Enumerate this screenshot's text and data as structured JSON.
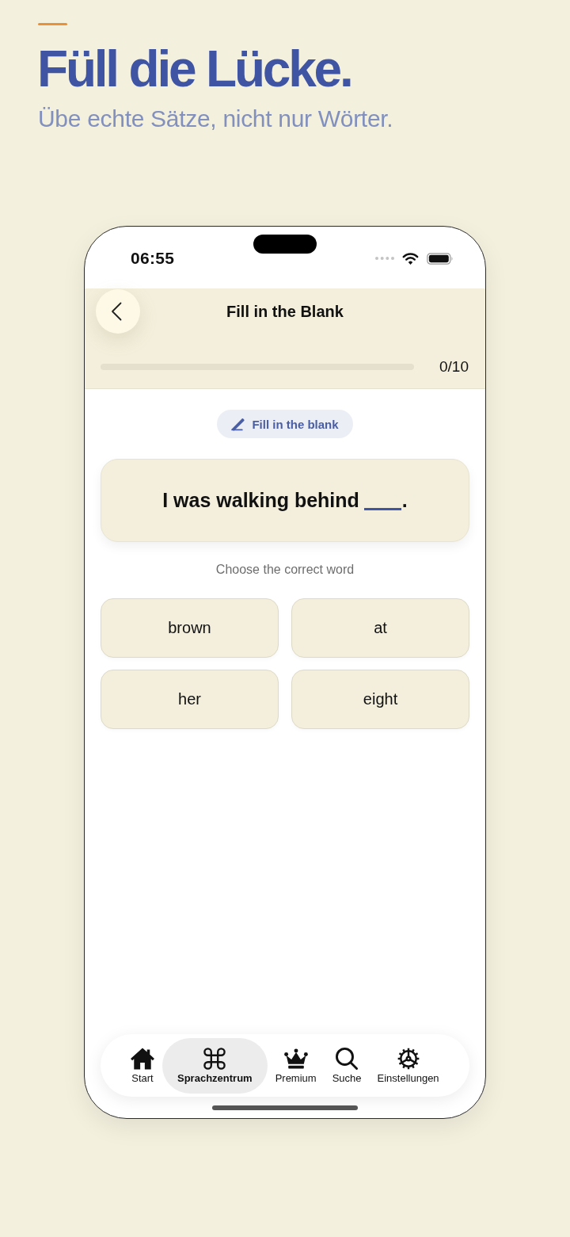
{
  "promo": {
    "title": "Füll die Lücke.",
    "subtitle": "Übe echte Sätze, nicht nur Wörter."
  },
  "status_bar": {
    "time": "06:55"
  },
  "nav": {
    "title": "Fill in the Blank",
    "progress": {
      "level": 0,
      "reading": "0/10"
    }
  },
  "exercise": {
    "tag": "Fill in the blank",
    "sentence": {
      "before": "I was walking behind",
      "after": "."
    },
    "instruction": "Choose the correct word",
    "options": [
      {
        "label": "brown",
        "selected": false
      },
      {
        "label": "at",
        "selected": false
      },
      {
        "label": "her",
        "selected": false
      },
      {
        "label": "eight",
        "selected": false
      }
    ]
  },
  "tab_bar": {
    "items": [
      {
        "label": "Start",
        "selected": false
      },
      {
        "label": "Sprachzentrum",
        "selected": true
      },
      {
        "label": "Premium",
        "selected": false
      },
      {
        "label": "Suche",
        "selected": false
      },
      {
        "label": "Einstellungen",
        "selected": false
      }
    ]
  }
}
